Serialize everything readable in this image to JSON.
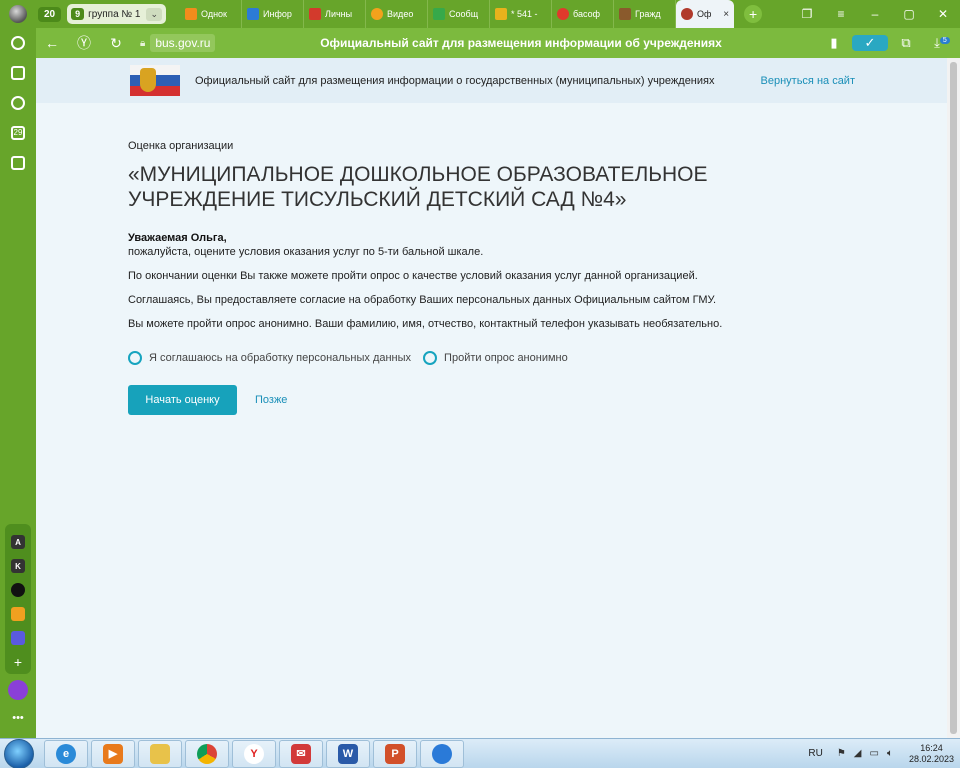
{
  "browser": {
    "tab_count": "20",
    "group": {
      "number": "9",
      "label": "группа № 1"
    },
    "tabs": [
      {
        "label": "Однок",
        "color": "#f28c1c"
      },
      {
        "label": "Инфор",
        "color": "#2c7bd6"
      },
      {
        "label": "Личны",
        "color": "#d33a2c"
      },
      {
        "label": "Видео",
        "color": "#f2a21c"
      },
      {
        "label": "Сообщ",
        "color": "#37a94a"
      },
      {
        "label": "* 541 -",
        "color": "#e8b21c"
      },
      {
        "label": "басоф",
        "color": "#e03a2c"
      },
      {
        "label": "Гражд",
        "color": "#8a5a2c"
      }
    ],
    "active_tab": {
      "label": "Оф",
      "close": "×"
    },
    "new_tab": "+",
    "address": {
      "host": "bus.gov.ru"
    },
    "page_title": "Официальный сайт для размещения информации об учреждениях",
    "downloads_badge": "5"
  },
  "site": {
    "name": "Официальный сайт для размещения информации о государственных (муниципальных) учреждениях",
    "back_link": "Вернуться на сайт"
  },
  "content": {
    "breadcrumb": "Оценка организации",
    "title": "«МУНИЦИПАЛЬНОЕ ДОШКОЛЬНОЕ ОБРАЗОВАТЕЛЬНОЕ УЧРЕЖДЕНИЕ ТИСУЛЬСКИЙ ДЕТСКИЙ САД №4»",
    "greeting": "Уважаемая Ольга,",
    "p1": "пожалуйста, оцените условия оказания услуг по 5-ти бальной шкале.",
    "p2": "По окончании оценки Вы также можете пройти опрос о качестве условий оказания услуг данной организацией.",
    "p3": "Соглашаясь, Вы предоставляете согласие на обработку Ваших персональных данных Официальным сайтом ГМУ.",
    "p4": "Вы можете пройти опрос анонимно. Ваши фамилию, имя, отчество, контактный телефон указывать необязательно.",
    "option_consent": "Я соглашаюсь на обработку персональных данных",
    "option_anonymous": "Пройти опрос анонимно",
    "start_button": "Начать оценку",
    "later_link": "Позже"
  },
  "sidebar_apps": [
    "A",
    "K"
  ],
  "taskbar": {
    "lang": "RU",
    "time": "16:24",
    "date": "28.02.2023"
  },
  "colors": {
    "browser_green": "#67a52a",
    "accent": "#17a2bb",
    "link": "#1a8fb8"
  }
}
